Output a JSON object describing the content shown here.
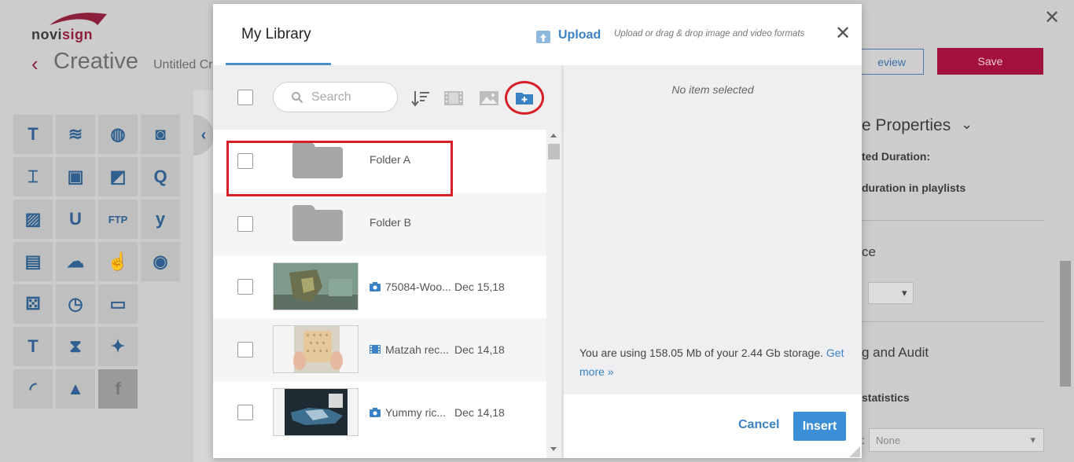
{
  "app": {
    "logo_no": "novi",
    "logo_sign": "sign",
    "title": "Creative",
    "subtitle": "Untitled Cr",
    "preview_label": "eview",
    "save_label": "Save",
    "close_glyph": "✕",
    "back_glyph": "‹"
  },
  "widgets": [
    {
      "icon": "text-icon",
      "glyph": "T"
    },
    {
      "icon": "rss-icon",
      "glyph": "≋"
    },
    {
      "icon": "globe-icon",
      "glyph": "◍"
    },
    {
      "icon": "instagram-icon",
      "glyph": "◙"
    },
    {
      "icon": "text-box-icon",
      "glyph": "⌶"
    },
    {
      "icon": "youtube-icon",
      "glyph": "▣"
    },
    {
      "icon": "web-image-icon",
      "glyph": "◩"
    },
    {
      "icon": "q-icon",
      "glyph": "Q"
    },
    {
      "icon": "image-icon",
      "glyph": "▨"
    },
    {
      "icon": "u-icon",
      "glyph": "U"
    },
    {
      "icon": "ftp-icon",
      "glyph": "FTP"
    },
    {
      "icon": "yammer-icon",
      "glyph": "y"
    },
    {
      "icon": "video-icon",
      "glyph": "▤"
    },
    {
      "icon": "weather-icon",
      "glyph": "☁"
    },
    {
      "icon": "touch-icon",
      "glyph": "☝"
    },
    {
      "icon": "broadcast-icon",
      "glyph": "◉"
    },
    {
      "icon": "dice-icon",
      "glyph": "⚄"
    },
    {
      "icon": "clock-icon",
      "glyph": "◷"
    },
    {
      "icon": "tv-icon",
      "glyph": "▭"
    },
    {
      "icon": "empty-slot",
      "glyph": ""
    },
    {
      "icon": "ticker-icon",
      "glyph": "T"
    },
    {
      "icon": "hourglass-icon",
      "glyph": "⧗"
    },
    {
      "icon": "twitter-icon",
      "glyph": "✦"
    },
    {
      "icon": "empty-slot",
      "glyph": ""
    },
    {
      "icon": "feed-icon",
      "glyph": "◜"
    },
    {
      "icon": "shapes-icon",
      "glyph": "▲"
    },
    {
      "icon": "facebook-icon",
      "glyph": "f"
    }
  ],
  "properties": {
    "heading": "e Properties",
    "duration_label": "ted Duration:",
    "playlist_label": "duration in playlists",
    "section2": "ce",
    "section3": "g and Audit",
    "statistics": "statistics",
    "select_value": "None",
    "select_label": ":"
  },
  "modal": {
    "title": "My Library",
    "upload_label": "Upload",
    "upload_hint": "Upload or drag & drop image and video formats",
    "close_glyph": "✕",
    "search_placeholder": "Search",
    "no_item": "No item selected",
    "storage_text": "You are using 158.05 Mb of your 2.44 Gb storage.",
    "storage_link": "Get more »",
    "cancel_label": "Cancel",
    "insert_label": "Insert",
    "rows": [
      {
        "kind": "folder",
        "name": "Folder A"
      },
      {
        "kind": "folder",
        "name": "Folder B"
      },
      {
        "kind": "image",
        "name": "75084-Woo...",
        "date": "Dec 15,18"
      },
      {
        "kind": "video",
        "name": "Matzah rec...",
        "date": "Dec 14,18"
      },
      {
        "kind": "image",
        "name": "Yummy ric...",
        "date": "Dec 14,18"
      }
    ]
  },
  "colors": {
    "accent": "#3b82c4",
    "save": "#a3123e",
    "annotation": "#d62028"
  }
}
